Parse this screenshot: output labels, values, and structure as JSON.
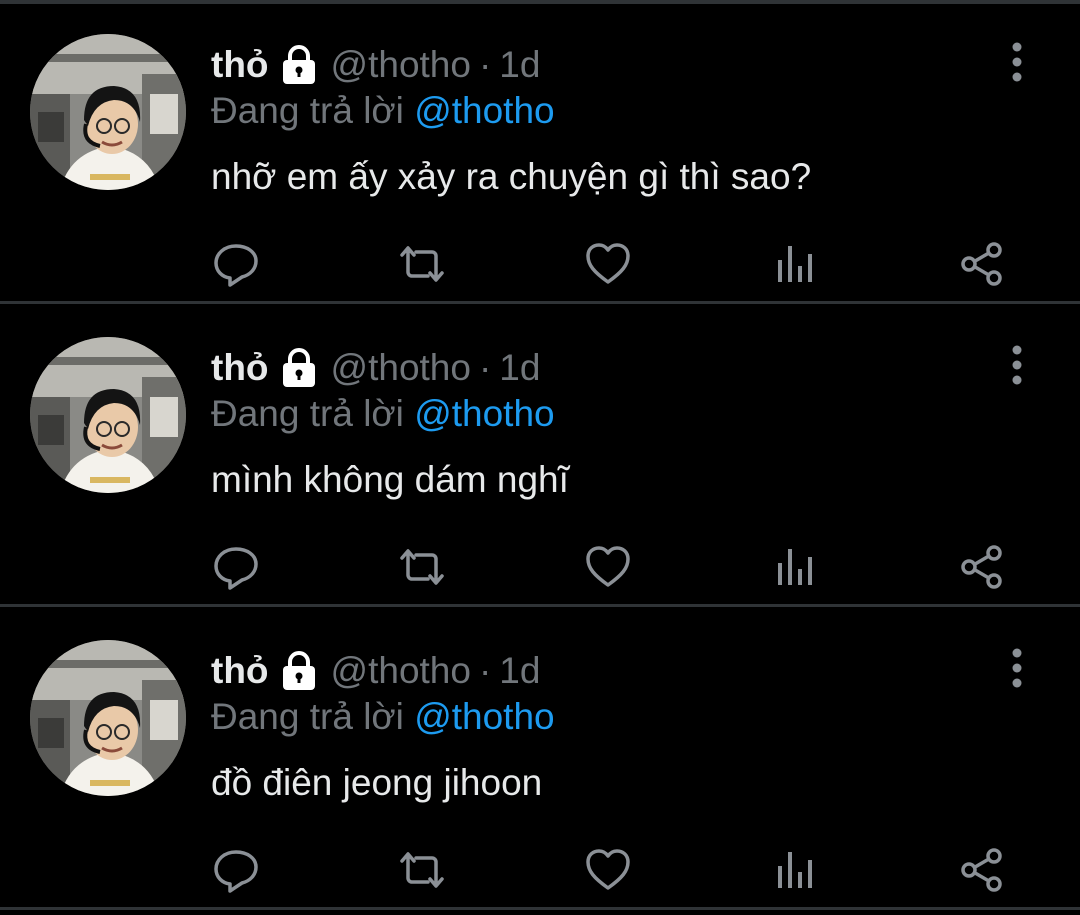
{
  "colors": {
    "background": "#000000",
    "divider": "#2f3336",
    "primary_text": "#e7e9ea",
    "secondary_text": "#71767b",
    "mention": "#1d9bf0"
  },
  "tweets": [
    {
      "display_name": "thỏ",
      "handle": "@thotho",
      "separator": "·",
      "time": "1d",
      "reply_prefix": "Đang trả lời",
      "reply_to": "@thotho",
      "text": "nhỡ em ấy xảy ra chuyện gì thì sao?",
      "icons": {
        "lock": "lock-icon",
        "more": "more-vertical-icon",
        "reply": "reply-icon",
        "retweet": "retweet-icon",
        "like": "heart-icon",
        "views": "analytics-icon",
        "share": "share-icon"
      }
    },
    {
      "display_name": "thỏ",
      "handle": "@thotho",
      "separator": "·",
      "time": "1d",
      "reply_prefix": "Đang trả lời",
      "reply_to": "@thotho",
      "text": "mình không dám nghĩ",
      "icons": {
        "lock": "lock-icon",
        "more": "more-vertical-icon",
        "reply": "reply-icon",
        "retweet": "retweet-icon",
        "like": "heart-icon",
        "views": "analytics-icon",
        "share": "share-icon"
      }
    },
    {
      "display_name": "thỏ",
      "handle": "@thotho",
      "separator": "·",
      "time": "1d",
      "reply_prefix": "Đang trả lời",
      "reply_to": "@thotho",
      "text": "đồ điên jeong jihoon",
      "icons": {
        "lock": "lock-icon",
        "more": "more-vertical-icon",
        "reply": "reply-icon",
        "retweet": "retweet-icon",
        "like": "heart-icon",
        "views": "analytics-icon",
        "share": "share-icon"
      }
    }
  ]
}
